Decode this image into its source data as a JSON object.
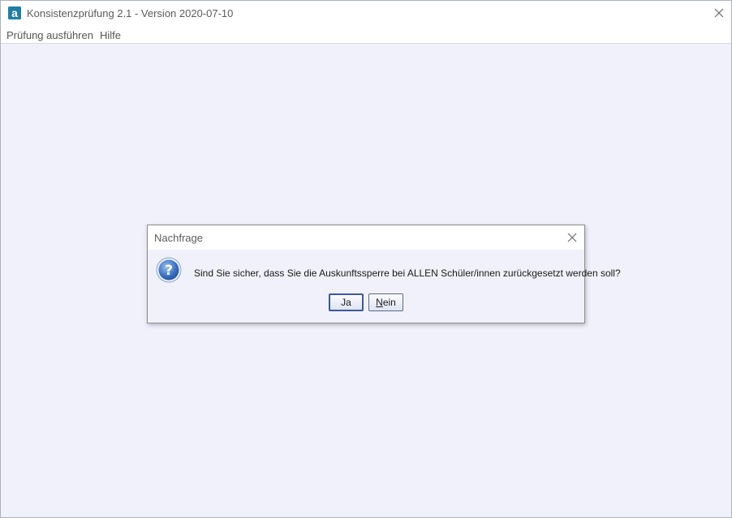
{
  "window": {
    "title": "Konsistenzprüfung 2.1 - Version 2020-07-10",
    "app_icon_letter": "a",
    "accent": "#1f7ea6",
    "background": "#f1f1fc"
  },
  "menubar": {
    "items": [
      {
        "label": "Prüfung ausführen"
      },
      {
        "label": "Hilfe"
      }
    ]
  },
  "dialog": {
    "title": "Nachfrage",
    "message": "Sind Sie sicher, dass Sie die Auskunftssperre bei ALLEN Schüler/innen zurückgesetzt werden soll?",
    "icon": "question-icon",
    "buttons": {
      "yes": {
        "label": "Ja"
      },
      "no": {
        "mnemonic": "N",
        "rest": "ein"
      }
    }
  }
}
